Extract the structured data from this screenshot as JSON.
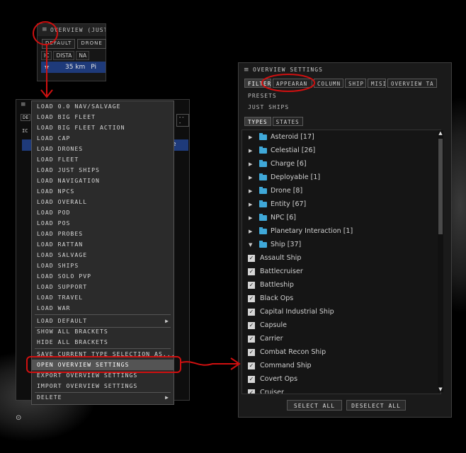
{
  "small_overview": {
    "title": "OVERVIEW (JUST",
    "tabs": [
      "DEFAULT",
      "DRONE"
    ],
    "columns": [
      "IC",
      "DISTA",
      "NA"
    ],
    "row": {
      "distance": "35 km",
      "name": "Pi"
    }
  },
  "back_window": {
    "tab_fragments": [
      "DE",
      "---"
    ],
    "col_fragment": "IC",
    "row_tail": "e"
  },
  "context_menu": {
    "items": [
      "LOAD 0.0 NAV/SALVAGE",
      "LOAD BIG FLEET",
      "LOAD BIG FLEET ACTION",
      "LOAD CAP",
      "LOAD DRONES",
      "LOAD FLEET",
      "LOAD JUST SHIPS",
      "LOAD NAVIGATION",
      "LOAD NPCS",
      "LOAD OVERALL",
      "LOAD POD",
      "LOAD POS",
      "LOAD PROBES",
      "LOAD RATTAN",
      "LOAD SALVAGE",
      "LOAD SHIPS",
      "LOAD SOLO PVP",
      "LOAD SUPPORT",
      "LOAD TRAVEL",
      "LOAD WAR"
    ],
    "load_default": "LOAD DEFAULT",
    "show_all_brackets": "SHOW ALL BRACKETS",
    "hide_all_brackets": "HIDE ALL BRACKETS",
    "save_current": "SAVE CURRENT TYPE SELECTION AS...",
    "open_settings": "OPEN OVERVIEW SETTINGS",
    "export_settings": "EXPORT OVERVIEW SETTINGS",
    "import_settings": "IMPORT OVERVIEW SETTINGS",
    "delete": "DELETE"
  },
  "settings": {
    "title": "OVERVIEW SETTINGS",
    "tabs": [
      "FILTER",
      "APPEARAN",
      "COLUMN",
      "SHIP",
      "MISI",
      "OVERVIEW TA"
    ],
    "presets_label": "PRESETS",
    "preset_value": "JUST SHIPS",
    "sub_tabs": [
      "TYPES",
      "STATES"
    ],
    "groups": [
      "Asteroid [17]",
      "Celestial [26]",
      "Charge [6]",
      "Deployable [1]",
      "Drone [8]",
      "Entity [67]",
      "NPC [6]",
      "Planetary Interaction [1]",
      "Ship [37]"
    ],
    "ship_types": [
      "Assault Ship",
      "Battlecruiser",
      "Battleship",
      "Black Ops",
      "Capital Industrial Ship",
      "Capsule",
      "Carrier",
      "Combat Recon Ship",
      "Command Ship",
      "Covert Ops",
      "Cruiser"
    ],
    "select_all": "SELECT ALL",
    "deselect_all": "DESELECT ALL"
  },
  "colors": {
    "annotation": "#d01010",
    "selection": "#1e3a7a",
    "folder": "#3fa8d8"
  },
  "icons": [
    "hamburger-icon",
    "folder-icon",
    "checkbox-icon",
    "expand-arrow-icon",
    "scroll-arrow-icon",
    "locate-icon"
  ]
}
